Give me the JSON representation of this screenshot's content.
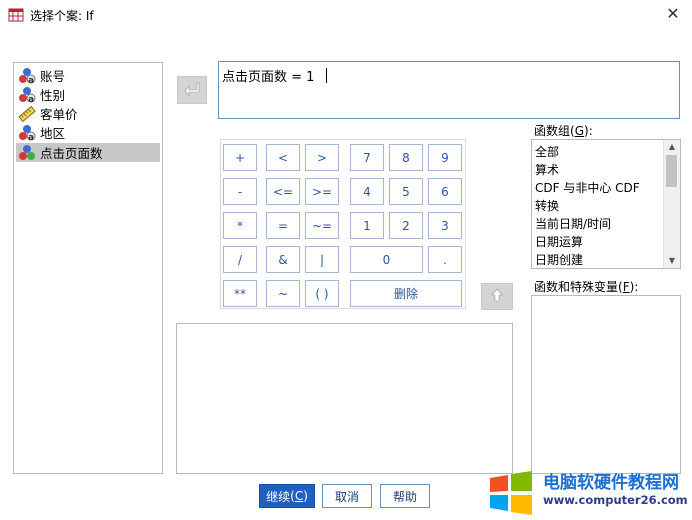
{
  "window": {
    "title": "选择个案: If"
  },
  "variables": [
    {
      "label": "账号",
      "icon": "nominal-variable-icon",
      "selected": false
    },
    {
      "label": "性别",
      "icon": "nominal-variable-icon",
      "selected": false
    },
    {
      "label": "客单价",
      "icon": "scale-variable-icon",
      "selected": false
    },
    {
      "label": "地区",
      "icon": "nominal-variable-icon",
      "selected": false
    },
    {
      "label": "点击页面数",
      "icon": "ordinal-variable-icon",
      "selected": true
    }
  ],
  "expression": {
    "value": "点击页面数 = 1"
  },
  "keypad": {
    "plus": "+",
    "lt": "<",
    "gt": ">",
    "d7": "7",
    "d8": "8",
    "d9": "9",
    "minus": "-",
    "le": "<=",
    "ge": ">=",
    "d4": "4",
    "d5": "5",
    "d6": "6",
    "mult": "*",
    "eq": "=",
    "ne": "~=",
    "d1": "1",
    "d2": "2",
    "d3": "3",
    "div": "/",
    "and": "&",
    "or": "|",
    "d0": "0",
    "dot": ".",
    "pow": "**",
    "not": "~",
    "paren": "( )",
    "delete": "删除"
  },
  "function_group": {
    "label": "函数组",
    "hotkey": "G",
    "items": [
      "全部",
      "算术",
      "CDF 与非中心 CDF",
      "转换",
      "当前日期/时间",
      "日期运算",
      "日期创建"
    ]
  },
  "functions_label": {
    "label": "函数和特殊变量",
    "hotkey": "F"
  },
  "buttons": {
    "continue": {
      "label": "继续",
      "hotkey": "C"
    },
    "cancel": "取消",
    "help": "帮助"
  },
  "watermark": {
    "name": "电脑软硬件教程网",
    "url": "www.computer26.com"
  },
  "colors": {
    "accent": "#1f5fbf",
    "selection": "#c8c8c8",
    "key_text": "#2b57a0"
  }
}
